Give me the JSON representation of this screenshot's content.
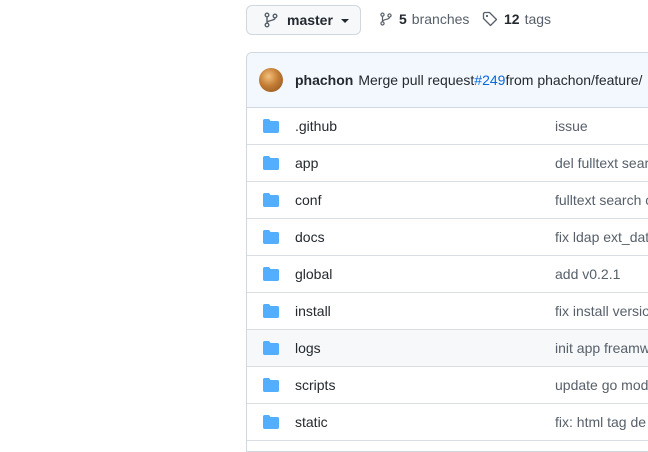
{
  "branch": {
    "name": "master"
  },
  "branches": {
    "count": "5",
    "label": "branches"
  },
  "tags": {
    "count": "12",
    "label": "tags"
  },
  "commit": {
    "author": "phachon",
    "message_prefix": "Merge pull request ",
    "pr": "#249",
    "message_suffix": " from phachon/feature/"
  },
  "files": [
    {
      "name": ".github",
      "message": "issue"
    },
    {
      "name": "app",
      "message": "del fulltext sear"
    },
    {
      "name": "conf",
      "message": "fulltext search c"
    },
    {
      "name": "docs",
      "message": "fix ldap ext_dat"
    },
    {
      "name": "global",
      "message": "add v0.2.1"
    },
    {
      "name": "install",
      "message": "fix install versio"
    },
    {
      "name": "logs",
      "message": "init app freamw"
    },
    {
      "name": "scripts",
      "message": "update go mod"
    },
    {
      "name": "static",
      "message": "fix: html tag de"
    }
  ],
  "colors": {
    "folder": "#54aeff",
    "link": "#0969da",
    "commit_bar": "#f3f8ff"
  }
}
